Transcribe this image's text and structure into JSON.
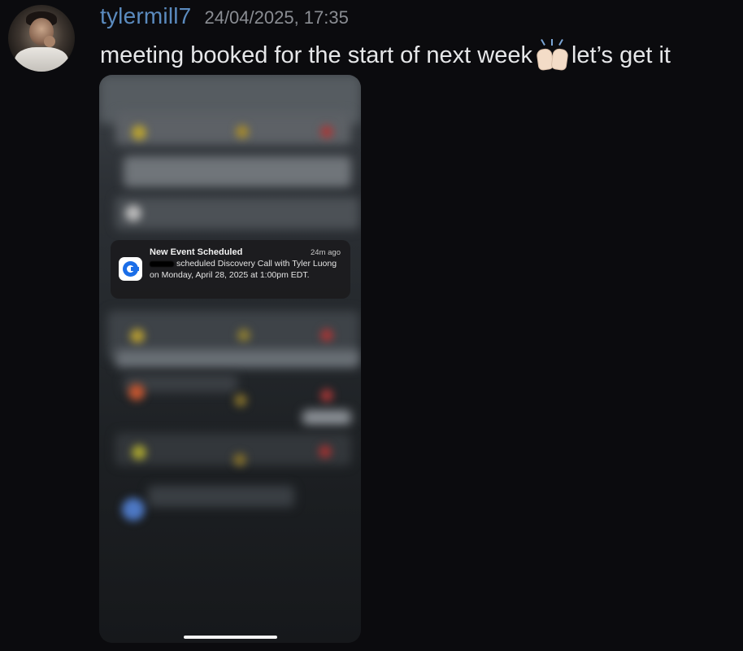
{
  "message": {
    "username": "tylermill7",
    "timestamp": "24/04/2025, 17:35",
    "text_before": "meeting booked for the start of next week",
    "emoji": "raising-hands-emoji",
    "text_after": "let’s get it"
  },
  "notification": {
    "title": "New Event Scheduled",
    "time": "24m ago",
    "body": "scheduled Discovery Call with Tyler Luong on Monday, April 28, 2025 at 1:00pm EDT.",
    "app_icon": "calendly-icon",
    "icon_color": "#1b6ee8"
  },
  "colors": {
    "username": "#5b8bbf",
    "background": "#0b0b0e"
  }
}
